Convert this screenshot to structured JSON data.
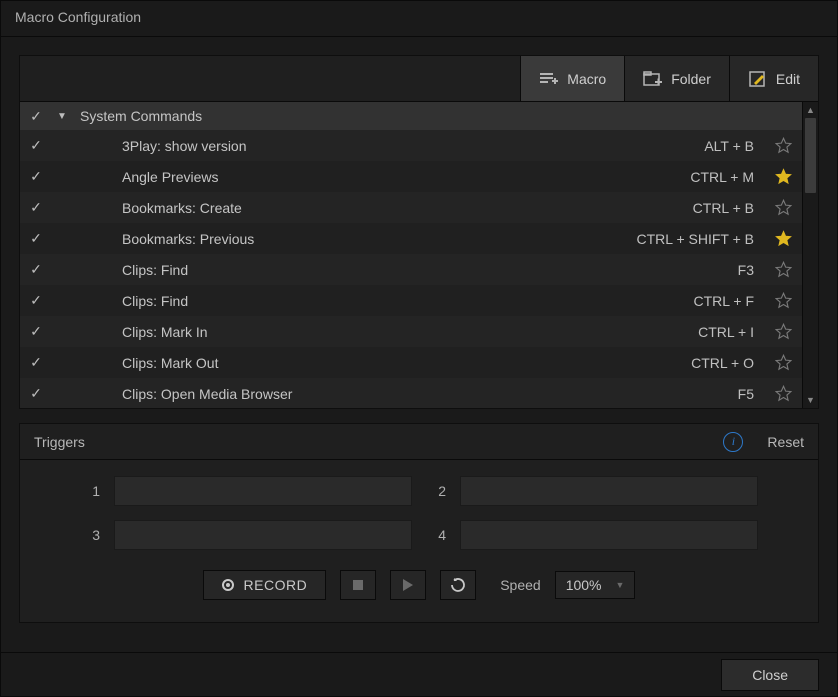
{
  "title": "Macro Configuration",
  "toolbar": {
    "macro_label": "Macro",
    "folder_label": "Folder",
    "edit_label": "Edit"
  },
  "group": {
    "name": "System Commands"
  },
  "items": [
    {
      "name": "3Play: show version",
      "shortcut": "ALT + B",
      "starred": false
    },
    {
      "name": "Angle Previews",
      "shortcut": "CTRL + M",
      "starred": true
    },
    {
      "name": "Bookmarks: Create",
      "shortcut": "CTRL + B",
      "starred": false
    },
    {
      "name": "Bookmarks: Previous",
      "shortcut": "CTRL + SHIFT + B",
      "starred": true
    },
    {
      "name": "Clips: Find",
      "shortcut": "F3",
      "starred": false
    },
    {
      "name": "Clips: Find",
      "shortcut": "CTRL + F",
      "starred": false
    },
    {
      "name": "Clips: Mark In",
      "shortcut": "CTRL + I",
      "starred": false
    },
    {
      "name": "Clips: Mark Out",
      "shortcut": "CTRL + O",
      "starred": false
    },
    {
      "name": "Clips: Open Media Browser",
      "shortcut": "F5",
      "starred": false
    }
  ],
  "triggers": {
    "title": "Triggers",
    "reset_label": "Reset",
    "slots": [
      "1",
      "2",
      "3",
      "4"
    ],
    "values": [
      "",
      "",
      "",
      ""
    ]
  },
  "controls": {
    "record_label": "RECORD",
    "speed_label": "Speed",
    "speed_value": "100%"
  },
  "footer": {
    "close_label": "Close"
  }
}
